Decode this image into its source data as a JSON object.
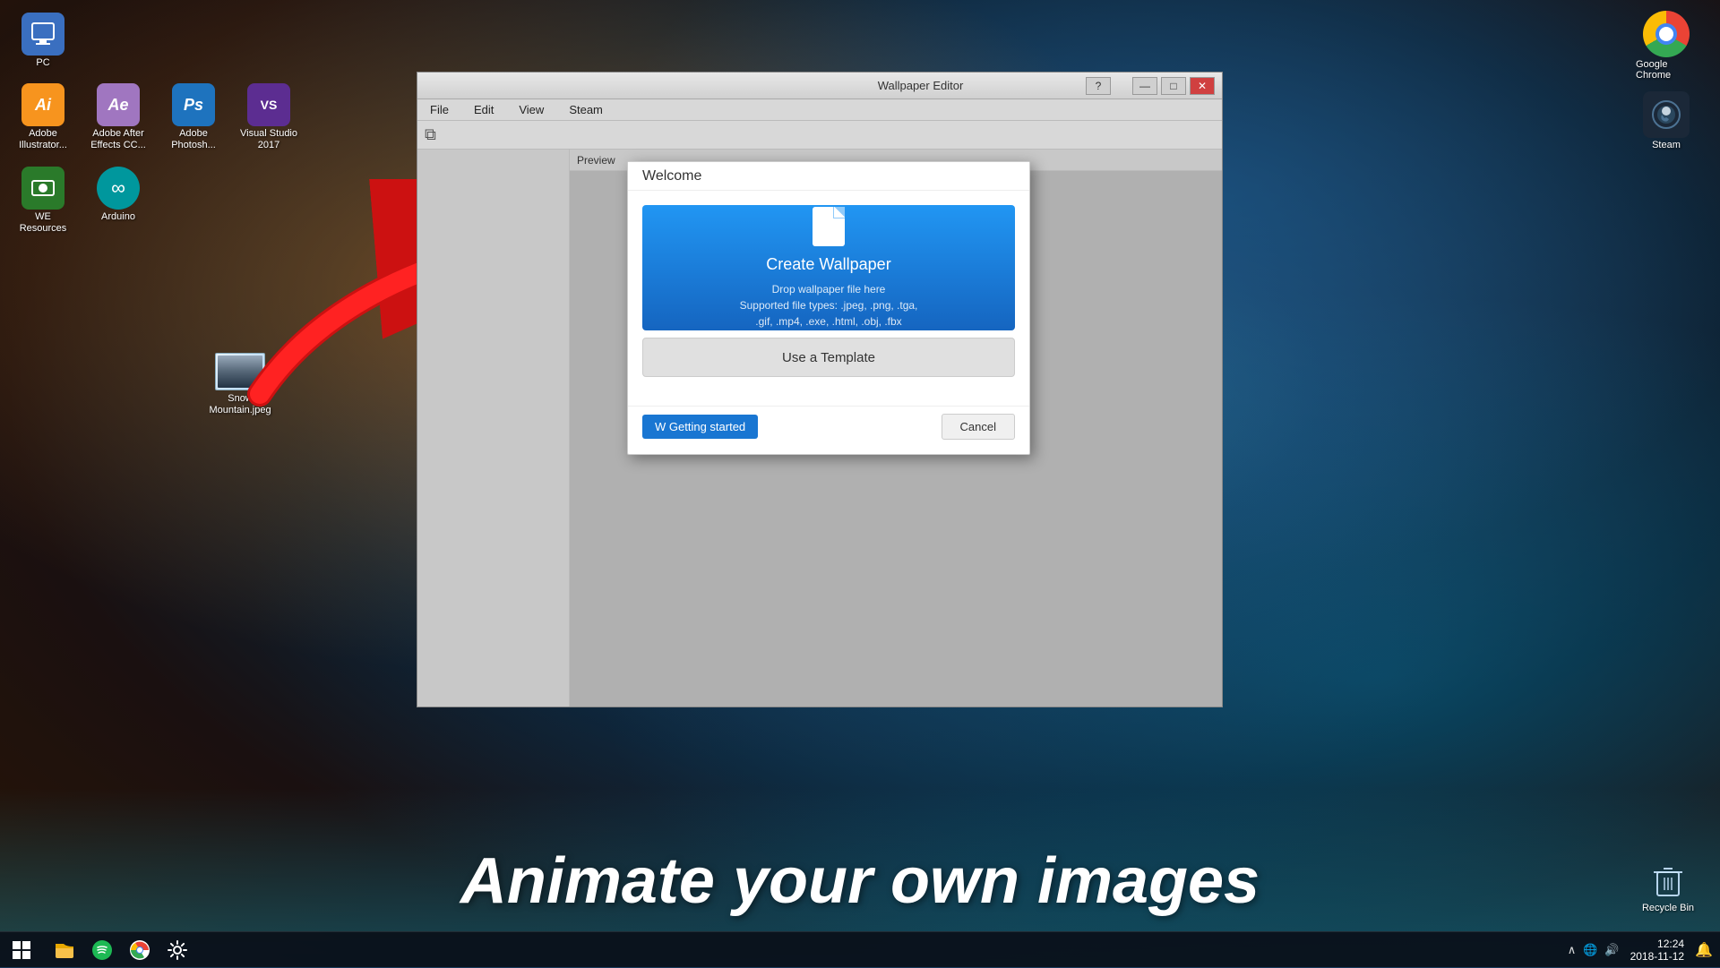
{
  "desktop": {
    "icons_left": [
      {
        "id": "pc",
        "label": "PC",
        "color": "#3a6fc0",
        "symbol": "🖥️"
      },
      {
        "id": "illustrator",
        "label": "Adobe Illustrator...",
        "color": "#f7941e",
        "symbol": "Ai"
      },
      {
        "id": "aftereffects",
        "label": "Adobe After Effects CC...",
        "color": "#a076c0",
        "symbol": "Ae"
      },
      {
        "id": "photoshop",
        "label": "Adobe Photosh...",
        "color": "#1e73be",
        "symbol": "Ps"
      },
      {
        "id": "vs2017",
        "label": "Visual Studio 2017",
        "color": "#5c2d91",
        "symbol": "VS"
      },
      {
        "id": "weresources",
        "label": "WE Resources",
        "color": "#2a7a2a",
        "symbol": "WE"
      },
      {
        "id": "arduino",
        "label": "Arduino",
        "color": "#00979d",
        "symbol": "⚙"
      }
    ],
    "file_icon": {
      "label": "Snow Mountain.jpeg",
      "type": "image"
    },
    "caption": "Animate your own images"
  },
  "tray": {
    "apps": [
      {
        "id": "chrome",
        "label": "Google Chrome",
        "color": "#e04030",
        "symbol": "🌐"
      },
      {
        "id": "steam",
        "label": "Steam",
        "color": "#1b2838",
        "symbol": "♨"
      }
    ]
  },
  "taskbar": {
    "time": "12:24",
    "date": "2018-11-12",
    "icons": [
      "start",
      "file-explorer",
      "spotify",
      "chrome",
      "settings"
    ]
  },
  "wallpaper_editor": {
    "title": "Wallpaper Editor",
    "menu_items": [
      "File",
      "Edit",
      "View",
      "Steam"
    ],
    "preview_tab": "Preview"
  },
  "welcome_dialog": {
    "title": "Welcome",
    "create_wallpaper": {
      "label": "Create Wallpaper",
      "subtitle_line1": "Drop wallpaper file here",
      "subtitle_line2": "Supported file types: .jpeg, .png, .tga,",
      "subtitle_line3": ".gif, .mp4, .exe, .html, .obj, .fbx"
    },
    "use_template_label": "Use a Template",
    "getting_started_label": "W Getting started",
    "cancel_label": "Cancel"
  }
}
